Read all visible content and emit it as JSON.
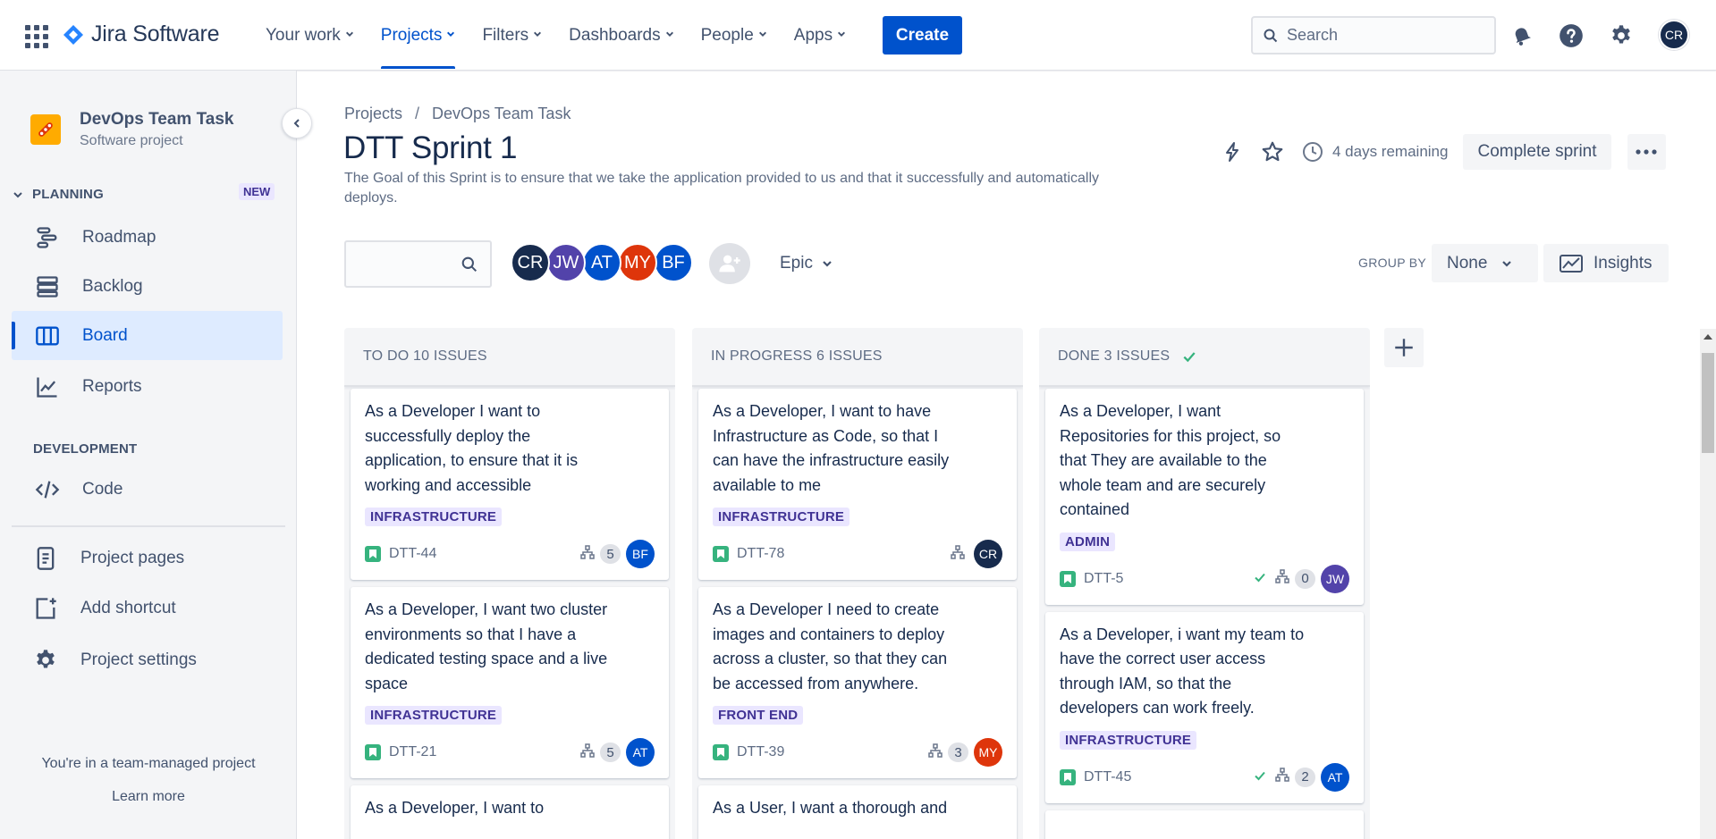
{
  "topnav": {
    "product": "Jira Software",
    "items": [
      {
        "label": "Your work",
        "active": false
      },
      {
        "label": "Projects",
        "active": true
      },
      {
        "label": "Filters",
        "active": false
      },
      {
        "label": "Dashboards",
        "active": false
      },
      {
        "label": "People",
        "active": false
      },
      {
        "label": "Apps",
        "active": false
      }
    ],
    "create_label": "Create",
    "search_placeholder": "Search",
    "user_initials": "CR"
  },
  "sidebar": {
    "project_name": "DevOps Team Task",
    "project_type": "Software project",
    "planning_label": "PLANNING",
    "new_badge": "NEW",
    "planning_items": [
      {
        "label": "Roadmap",
        "icon": "roadmap-icon"
      },
      {
        "label": "Backlog",
        "icon": "backlog-icon"
      },
      {
        "label": "Board",
        "icon": "board-icon",
        "active": true
      },
      {
        "label": "Reports",
        "icon": "reports-icon"
      }
    ],
    "development_label": "DEVELOPMENT",
    "dev_items": [
      {
        "label": "Code",
        "icon": "code-icon"
      }
    ],
    "bottom_items": [
      {
        "label": "Project pages",
        "icon": "page-icon"
      },
      {
        "label": "Add shortcut",
        "icon": "add-shortcut-icon"
      },
      {
        "label": "Project settings",
        "icon": "gear-icon"
      }
    ],
    "footer_text": "You're in a team-managed project",
    "learn_more": "Learn more"
  },
  "main": {
    "breadcrumb": [
      "Projects",
      "DevOps Team Task"
    ],
    "breadcrumb_sep": "/",
    "title": "DTT Sprint 1",
    "sprint_goal": "The Goal of this Sprint is to ensure that we take the application provided to us and that it successfully and automatically deploys.",
    "remaining": "4 days remaining",
    "complete_sprint_label": "Complete sprint",
    "epic_label": "Epic",
    "group_by_label": "GROUP BY",
    "group_by_value": "None",
    "insights_label": "Insights",
    "people": [
      {
        "initials": "CR",
        "color": "#172b4d"
      },
      {
        "initials": "JW",
        "color": "#5243aa"
      },
      {
        "initials": "AT",
        "color": "#0052cc"
      },
      {
        "initials": "MY",
        "color": "#de350b"
      },
      {
        "initials": "BF",
        "color": "#0052cc"
      }
    ]
  },
  "columns": [
    {
      "title": "TO DO 10 ISSUES",
      "done": false,
      "cards": [
        {
          "title": "As a Developer I want to successfully deploy the application, to ensure that it is working and accessible",
          "label": "INFRASTRUCTURE",
          "key": "DTT-44",
          "children": "5",
          "assignee": "BF",
          "assignee_color": "#0052cc",
          "resolved": false
        },
        {
          "title": "As a Developer, I want two cluster environments so that I have a dedicated testing space and a live space",
          "label": "INFRASTRUCTURE",
          "key": "DTT-21",
          "children": "5",
          "assignee": "AT",
          "assignee_color": "#0052cc",
          "resolved": false
        },
        {
          "title": "As a Developer, I want to",
          "label": "",
          "key": "",
          "children": "",
          "assignee": "",
          "assignee_color": "",
          "resolved": false
        }
      ]
    },
    {
      "title": "IN PROGRESS 6 ISSUES",
      "done": false,
      "cards": [
        {
          "title": "As a Developer, I want to have Infrastructure as Code, so that I can have the infrastructure easily available to me",
          "label": "INFRASTRUCTURE",
          "key": "DTT-78",
          "children": "",
          "assignee": "CR",
          "assignee_color": "#172b4d",
          "resolved": false
        },
        {
          "title": "As a Developer I need to create images and containers to deploy across a cluster, so that they can be accessed from anywhere.",
          "label": "FRONT END",
          "key": "DTT-39",
          "children": "3",
          "assignee": "MY",
          "assignee_color": "#de350b",
          "resolved": false
        },
        {
          "title": "As a User, I want a thorough and",
          "label": "",
          "key": "",
          "children": "",
          "assignee": "",
          "assignee_color": "",
          "resolved": false
        }
      ]
    },
    {
      "title": "DONE 3 ISSUES",
      "done": true,
      "cards": [
        {
          "title": "As a Developer, I want Repositories for this project, so that They are available to the whole team and are securely contained",
          "label": "ADMIN",
          "key": "DTT-5",
          "children": "0",
          "assignee": "JW",
          "assignee_color": "#5243aa",
          "resolved": true
        },
        {
          "title": "As a Developer, i want my team to have the correct user access through IAM, so that the developers can work freely.",
          "label": "INFRASTRUCTURE",
          "key": "DTT-45",
          "children": "2",
          "assignee": "AT",
          "assignee_color": "#0052cc",
          "resolved": true
        },
        {
          "title": "",
          "label": "",
          "key": "",
          "children": "",
          "assignee": "",
          "assignee_color": "",
          "resolved": false
        }
      ]
    }
  ]
}
